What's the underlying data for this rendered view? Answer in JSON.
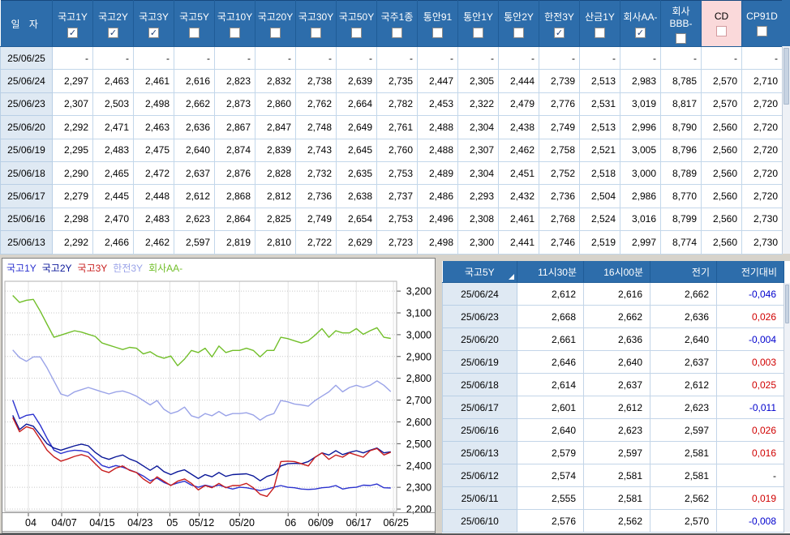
{
  "colors": {
    "header_blue": "#2d6dab",
    "pink_column": "#fad9da",
    "date_cell_bg": "#dfe9f3",
    "positive_change": "#d00000",
    "negative_change": "#0000cd"
  },
  "top_table": {
    "date_header": "일  자",
    "columns": [
      {
        "label": "국고1Y",
        "checked": true,
        "pink": false
      },
      {
        "label": "국고2Y",
        "checked": true,
        "pink": false
      },
      {
        "label": "국고3Y",
        "checked": true,
        "pink": false
      },
      {
        "label": "국고5Y",
        "checked": false,
        "pink": false
      },
      {
        "label": "국고10Y",
        "checked": false,
        "pink": false
      },
      {
        "label": "국고20Y",
        "checked": false,
        "pink": false
      },
      {
        "label": "국고30Y",
        "checked": false,
        "pink": false
      },
      {
        "label": "국고50Y",
        "checked": false,
        "pink": false
      },
      {
        "label": "국주1종",
        "checked": false,
        "pink": false
      },
      {
        "label": "통안91",
        "checked": false,
        "pink": false
      },
      {
        "label": "통안1Y",
        "checked": false,
        "pink": false
      },
      {
        "label": "통안2Y",
        "checked": false,
        "pink": false
      },
      {
        "label": "한전3Y",
        "checked": true,
        "pink": false
      },
      {
        "label": "산금1Y",
        "checked": false,
        "pink": false
      },
      {
        "label": "회사AA-",
        "checked": true,
        "pink": false
      },
      {
        "label": "회사BBB-",
        "checked": false,
        "pink": false
      },
      {
        "label": "CD",
        "checked": false,
        "pink": true
      },
      {
        "label": "CP91D",
        "checked": false,
        "pink": false
      }
    ],
    "rows": [
      {
        "date": "25/06/25",
        "values": [
          "-",
          "-",
          "-",
          "-",
          "-",
          "-",
          "-",
          "-",
          "-",
          "-",
          "-",
          "-",
          "-",
          "-",
          "-",
          "-",
          "-",
          "-"
        ]
      },
      {
        "date": "25/06/24",
        "values": [
          "2,297",
          "2,463",
          "2,461",
          "2,616",
          "2,823",
          "2,832",
          "2,738",
          "2,639",
          "2,735",
          "2,447",
          "2,305",
          "2,444",
          "2,739",
          "2,513",
          "2,983",
          "8,785",
          "2,570",
          "2,710"
        ]
      },
      {
        "date": "25/06/23",
        "values": [
          "2,307",
          "2,503",
          "2,498",
          "2,662",
          "2,873",
          "2,860",
          "2,762",
          "2,664",
          "2,782",
          "2,453",
          "2,322",
          "2,479",
          "2,776",
          "2,531",
          "3,019",
          "8,817",
          "2,570",
          "2,720"
        ]
      },
      {
        "date": "25/06/20",
        "values": [
          "2,292",
          "2,471",
          "2,463",
          "2,636",
          "2,867",
          "2,847",
          "2,748",
          "2,649",
          "2,761",
          "2,488",
          "2,304",
          "2,438",
          "2,749",
          "2,513",
          "2,996",
          "8,790",
          "2,560",
          "2,720"
        ]
      },
      {
        "date": "25/06/19",
        "values": [
          "2,295",
          "2,483",
          "2,475",
          "2,640",
          "2,874",
          "2,839",
          "2,743",
          "2,645",
          "2,760",
          "2,488",
          "2,307",
          "2,462",
          "2,758",
          "2,521",
          "3,005",
          "8,796",
          "2,560",
          "2,720"
        ]
      },
      {
        "date": "25/06/18",
        "values": [
          "2,290",
          "2,465",
          "2,472",
          "2,637",
          "2,876",
          "2,828",
          "2,732",
          "2,635",
          "2,753",
          "2,489",
          "2,304",
          "2,451",
          "2,752",
          "2,518",
          "3,000",
          "8,789",
          "2,560",
          "2,720"
        ]
      },
      {
        "date": "25/06/17",
        "values": [
          "2,279",
          "2,445",
          "2,448",
          "2,612",
          "2,868",
          "2,812",
          "2,736",
          "2,638",
          "2,737",
          "2,486",
          "2,293",
          "2,432",
          "2,736",
          "2,504",
          "2,986",
          "8,770",
          "2,560",
          "2,720"
        ]
      },
      {
        "date": "25/06/16",
        "values": [
          "2,298",
          "2,470",
          "2,483",
          "2,623",
          "2,864",
          "2,825",
          "2,749",
          "2,654",
          "2,753",
          "2,496",
          "2,308",
          "2,461",
          "2,768",
          "2,524",
          "3,016",
          "8,799",
          "2,560",
          "2,730"
        ]
      },
      {
        "date": "25/06/13",
        "values": [
          "2,292",
          "2,466",
          "2,462",
          "2,597",
          "2,819",
          "2,810",
          "2,722",
          "2,629",
          "2,723",
          "2,498",
          "2,300",
          "2,441",
          "2,746",
          "2,519",
          "2,997",
          "8,774",
          "2,560",
          "2,730"
        ]
      }
    ]
  },
  "quote_panel": {
    "title_column": "국고5Y",
    "headers": [
      "11시30분",
      "16시00분",
      "전기",
      "전기대비"
    ],
    "rows": [
      {
        "date": "25/06/24",
        "t1130": "2,612",
        "t1600": "2,616",
        "prev": "2,662",
        "change": "-0,046",
        "sign": "neg"
      },
      {
        "date": "25/06/23",
        "t1130": "2,668",
        "t1600": "2,662",
        "prev": "2,636",
        "change": "0,026",
        "sign": "pos"
      },
      {
        "date": "25/06/20",
        "t1130": "2,661",
        "t1600": "2,636",
        "prev": "2,640",
        "change": "-0,004",
        "sign": "neg"
      },
      {
        "date": "25/06/19",
        "t1130": "2,646",
        "t1600": "2,640",
        "prev": "2,637",
        "change": "0,003",
        "sign": "pos"
      },
      {
        "date": "25/06/18",
        "t1130": "2,614",
        "t1600": "2,637",
        "prev": "2,612",
        "change": "0,025",
        "sign": "pos"
      },
      {
        "date": "25/06/17",
        "t1130": "2,601",
        "t1600": "2,612",
        "prev": "2,623",
        "change": "-0,011",
        "sign": "neg"
      },
      {
        "date": "25/06/16",
        "t1130": "2,640",
        "t1600": "2,623",
        "prev": "2,597",
        "change": "0,026",
        "sign": "pos"
      },
      {
        "date": "25/06/13",
        "t1130": "2,579",
        "t1600": "2,597",
        "prev": "2,581",
        "change": "0,016",
        "sign": "pos"
      },
      {
        "date": "25/06/12",
        "t1130": "2,574",
        "t1600": "2,581",
        "prev": "2,581",
        "change": "-",
        "sign": "flat"
      },
      {
        "date": "25/06/11",
        "t1130": "2,555",
        "t1600": "2,581",
        "prev": "2,562",
        "change": "0,019",
        "sign": "pos"
      },
      {
        "date": "25/06/10",
        "t1130": "2,576",
        "t1600": "2,562",
        "prev": "2,570",
        "change": "-0,008",
        "sign": "neg"
      }
    ]
  },
  "chart_data": {
    "type": "line",
    "title": "",
    "xlabel": "",
    "ylabel": "",
    "grid": true,
    "legend_position": "top-left",
    "x_tick_labels": [
      "04",
      "04/07",
      "04/15",
      "04/23",
      "05",
      "05/12",
      "05/20",
      "06",
      "06/09",
      "06/17",
      "06/25"
    ],
    "x_tick_fractions": [
      0.06,
      0.145,
      0.242,
      0.339,
      0.421,
      0.496,
      0.599,
      0.723,
      0.8,
      0.897,
      0.992
    ],
    "y_tick_labels": [
      "3,200",
      "3,100",
      "3,000",
      "2,900",
      "2,800",
      "2,700",
      "2,600",
      "2,500",
      "2,400",
      "2,300",
      "2,200"
    ],
    "y_tick_values": [
      3.2,
      3.1,
      3.0,
      2.9,
      2.8,
      2.7,
      2.6,
      2.5,
      2.4,
      2.3,
      2.2
    ],
    "ylim": [
      2.189,
      3.245
    ],
    "series": [
      {
        "name": "회사AA-",
        "color": "#72bf2a",
        "values": [
          3.18,
          3.148,
          3.158,
          3.162,
          3.108,
          3.048,
          2.988,
          2.998,
          3.008,
          3.018,
          3.012,
          3.002,
          2.992,
          2.962,
          2.952,
          2.942,
          2.932,
          2.942,
          2.938,
          2.912,
          2.922,
          2.902,
          2.892,
          2.902,
          2.858,
          2.888,
          2.928,
          2.918,
          2.938,
          2.898,
          2.948,
          2.918,
          2.928,
          2.928,
          2.938,
          2.928,
          2.898,
          2.928,
          2.928,
          2.988,
          2.982,
          2.972,
          2.962,
          2.972,
          2.998,
          3.028,
          2.988,
          3.018,
          3.008,
          3.008,
          3.028,
          3.002,
          3.018,
          3.032,
          2.988,
          2.983
        ]
      },
      {
        "name": "한전3Y",
        "color": "#9aa3e8",
        "values": [
          2.93,
          2.895,
          2.878,
          2.898,
          2.898,
          2.848,
          2.788,
          2.728,
          2.718,
          2.738,
          2.748,
          2.758,
          2.748,
          2.738,
          2.728,
          2.738,
          2.742,
          2.732,
          2.718,
          2.698,
          2.678,
          2.698,
          2.658,
          2.638,
          2.648,
          2.668,
          2.628,
          2.618,
          2.638,
          2.628,
          2.648,
          2.628,
          2.638,
          2.638,
          2.642,
          2.632,
          2.608,
          2.628,
          2.638,
          2.698,
          2.692,
          2.682,
          2.678,
          2.672,
          2.698,
          2.718,
          2.738,
          2.768,
          2.738,
          2.758,
          2.768,
          2.758,
          2.768,
          2.788,
          2.768,
          2.739
        ]
      },
      {
        "name": "국고1Y",
        "color": "#2b32cf",
        "values": [
          2.7,
          2.615,
          2.63,
          2.635,
          2.585,
          2.525,
          2.47,
          2.455,
          2.465,
          2.47,
          2.468,
          2.46,
          2.43,
          2.4,
          2.39,
          2.4,
          2.392,
          2.38,
          2.368,
          2.352,
          2.33,
          2.342,
          2.322,
          2.31,
          2.32,
          2.328,
          2.31,
          2.3,
          2.31,
          2.302,
          2.31,
          2.3,
          2.292,
          2.3,
          2.298,
          2.292,
          2.285,
          2.292,
          2.3,
          2.308,
          2.3,
          2.298,
          2.292,
          2.29,
          2.292,
          2.298,
          2.3,
          2.308,
          2.292,
          2.298,
          2.3,
          2.31,
          2.308,
          2.315,
          2.298,
          2.297
        ]
      },
      {
        "name": "국고2Y",
        "color": "#0b1899",
        "values": [
          2.63,
          2.565,
          2.59,
          2.58,
          2.54,
          2.5,
          2.48,
          2.47,
          2.48,
          2.49,
          2.498,
          2.49,
          2.46,
          2.438,
          2.428,
          2.44,
          2.448,
          2.43,
          2.418,
          2.398,
          2.378,
          2.398,
          2.372,
          2.358,
          2.372,
          2.38,
          2.36,
          2.34,
          2.358,
          2.348,
          2.368,
          2.35,
          2.358,
          2.36,
          2.362,
          2.352,
          2.33,
          2.35,
          2.36,
          2.398,
          2.408,
          2.41,
          2.408,
          2.418,
          2.438,
          2.458,
          2.448,
          2.468,
          2.45,
          2.46,
          2.468,
          2.458,
          2.47,
          2.48,
          2.458,
          2.463
        ]
      },
      {
        "name": "국고3Y",
        "color": "#c81e1e",
        "values": [
          2.62,
          2.555,
          2.578,
          2.568,
          2.52,
          2.47,
          2.44,
          2.42,
          2.43,
          2.442,
          2.45,
          2.44,
          2.408,
          2.378,
          2.368,
          2.388,
          2.398,
          2.378,
          2.368,
          2.338,
          2.318,
          2.348,
          2.328,
          2.308,
          2.328,
          2.338,
          2.318,
          2.288,
          2.308,
          2.298,
          2.318,
          2.298,
          2.308,
          2.308,
          2.318,
          2.298,
          2.268,
          2.258,
          2.298,
          2.418,
          2.42,
          2.418,
          2.408,
          2.398,
          2.438,
          2.458,
          2.428,
          2.448,
          2.438,
          2.458,
          2.448,
          2.438,
          2.468,
          2.478,
          2.448,
          2.461
        ]
      }
    ],
    "legend_order": [
      "국고1Y",
      "국고2Y",
      "국고3Y",
      "한전3Y",
      "회사AA-"
    ]
  }
}
